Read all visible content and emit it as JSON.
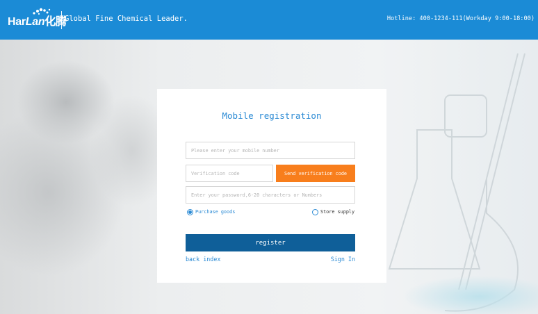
{
  "header": {
    "logo_text_a": "Har",
    "logo_text_b": "Lan",
    "logo_text_c": "化腾",
    "slogan": "Global Fine Chemical Leader.",
    "hotline": "Hotline: 400-1234-111(Workday 9:00-18:00)"
  },
  "form": {
    "title": "Mobile registration",
    "mobile_placeholder": "Please enter your mobile number",
    "code_placeholder": "Verification code",
    "send_code_label": "Send verification code",
    "password_placeholder": "Enter your password,6-20 characters or Numbers",
    "role_options": [
      {
        "label": "Purchase goods",
        "selected": true
      },
      {
        "label": "Store supply",
        "selected": false
      }
    ],
    "register_label": "register",
    "back_label": "back index",
    "signin_label": "Sign In"
  },
  "colors": {
    "header": "#1b8bd6",
    "accent": "#2a8ad4",
    "send_button": "#f87e1c",
    "register_button": "#0f5f99"
  }
}
